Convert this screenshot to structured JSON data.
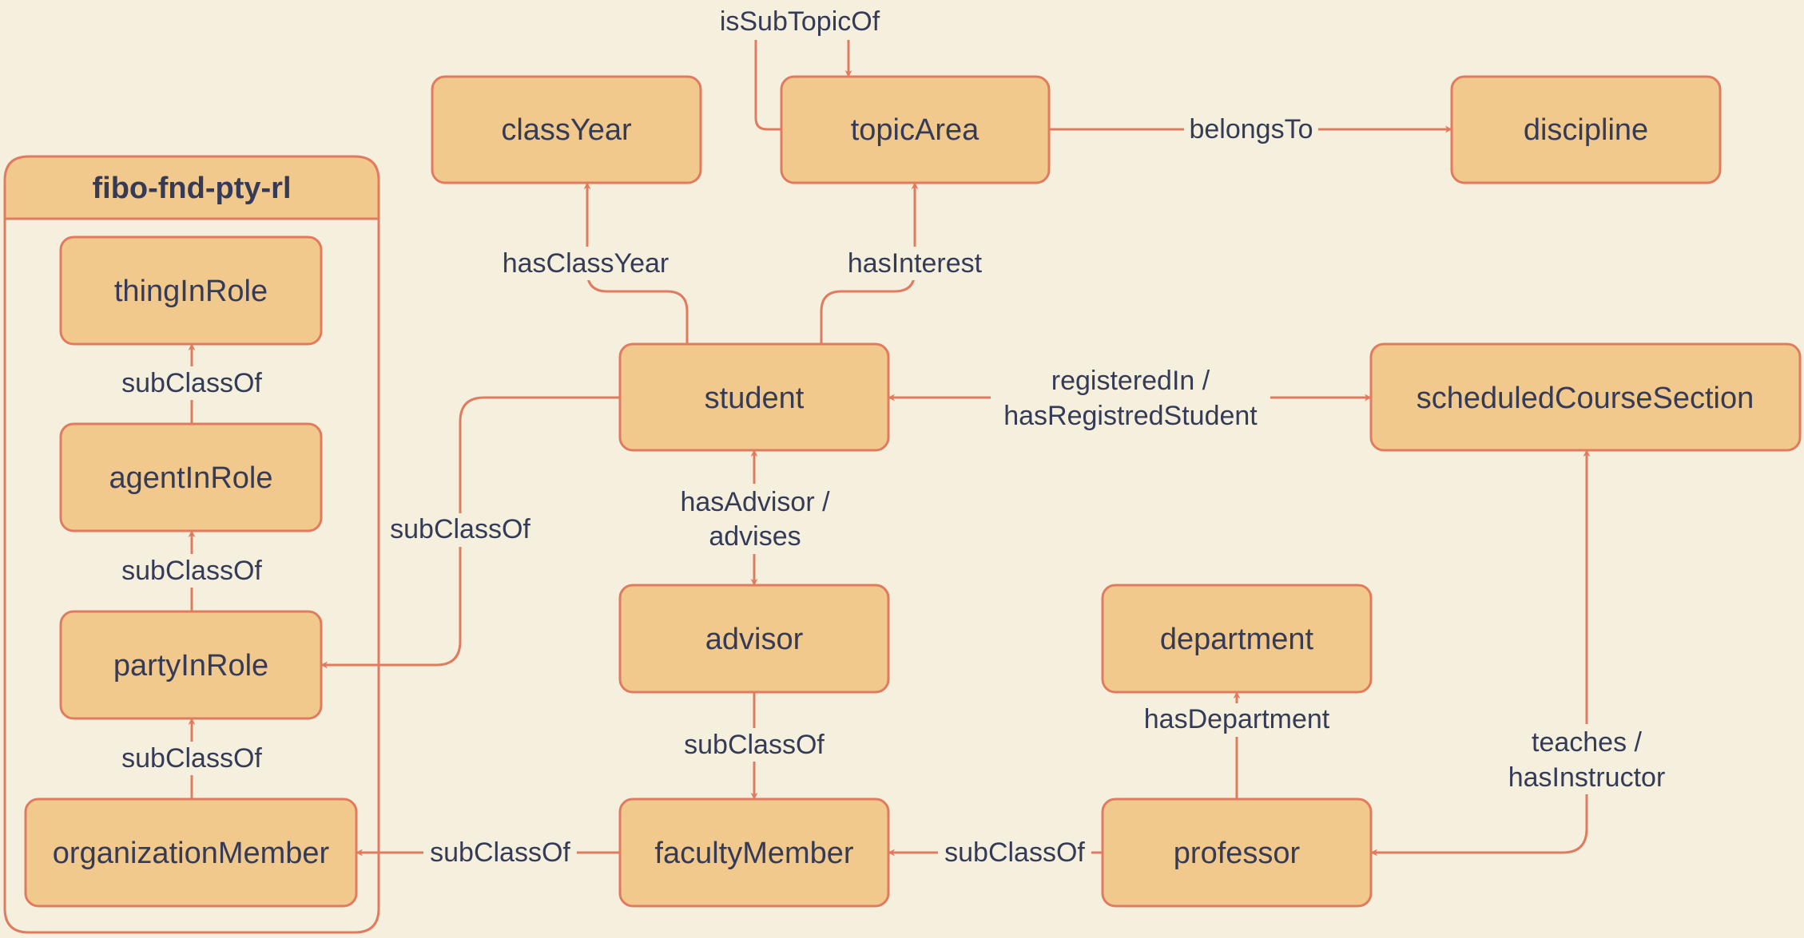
{
  "diagram": {
    "group": {
      "title": "fibo-fnd-pty-rl"
    },
    "nodes": {
      "classYear": "classYear",
      "topicArea": "topicArea",
      "discipline": "discipline",
      "thingInRole": "thingInRole",
      "agentInRole": "agentInRole",
      "partyInRole": "partyInRole",
      "organizationMember": "organizationMember",
      "student": "student",
      "scheduledCourseSection": "scheduledCourseSection",
      "advisor": "advisor",
      "department": "department",
      "facultyMember": "facultyMember",
      "professor": "professor"
    },
    "edges": {
      "isSubTopicOf": "isSubTopicOf",
      "belongsTo": "belongsTo",
      "hasClassYear": "hasClassYear",
      "hasInterest": "hasInterest",
      "registeredIn_line1": "registeredIn /",
      "registeredIn_line2": "hasRegistredStudent",
      "hasAdvisor_line1": "hasAdvisor /",
      "hasAdvisor_line2": "advises",
      "student_subClassOf": "subClassOf",
      "agent_subClassOf": "subClassOf",
      "party_subClassOf": "subClassOf",
      "orgmember_subClassOf": "subClassOf",
      "advisor_subClassOf": "subClassOf",
      "faculty_subClassOf": "subClassOf",
      "professor_subClassOf": "subClassOf",
      "hasDepartment": "hasDepartment",
      "teaches_line1": "teaches /",
      "teaches_line2": "hasInstructor"
    },
    "colors": {
      "background": "#f5f0de",
      "node_fill": "#f1c98d",
      "stroke": "#e07b5f",
      "text": "#353b57"
    }
  }
}
